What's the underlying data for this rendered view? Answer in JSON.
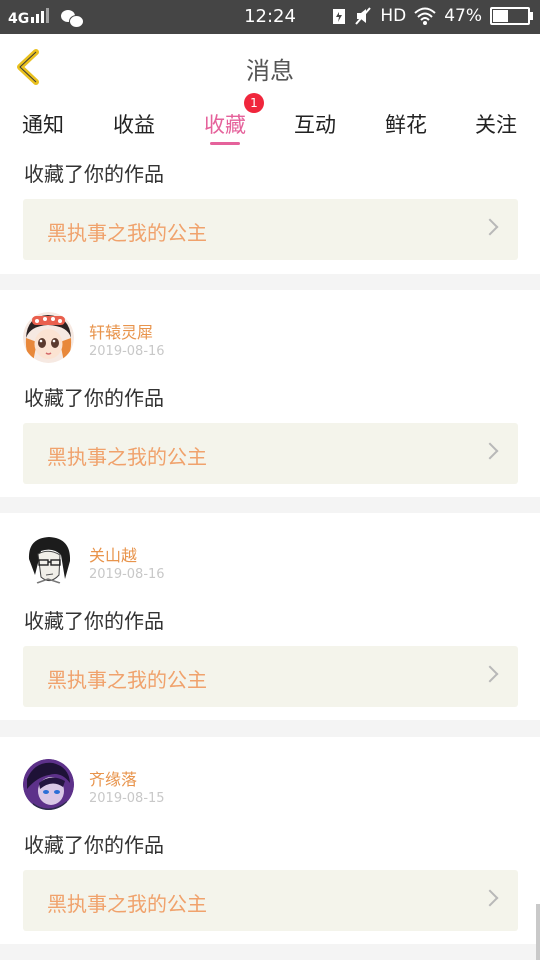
{
  "status_bar": {
    "network": "4G",
    "time": "12:24",
    "hd": "HD",
    "battery": "47%",
    "battery_level": 0.47
  },
  "header": {
    "title": "消息"
  },
  "tabs": [
    {
      "label": "通知"
    },
    {
      "label": "收益"
    },
    {
      "label": "收藏",
      "active": true,
      "badge": "1"
    },
    {
      "label": "互动"
    },
    {
      "label": "鲜花"
    },
    {
      "label": "关注"
    }
  ],
  "messages": [
    {
      "action": "收藏了你的作品",
      "work": "黑执事之我的公主"
    },
    {
      "user": "轩辕灵犀",
      "date": "2019-08-16",
      "action": "收藏了你的作品",
      "work": "黑执事之我的公主"
    },
    {
      "user": "关山越",
      "date": "2019-08-16",
      "action": "收藏了你的作品",
      "work": "黑执事之我的公主"
    },
    {
      "user": "齐缘落",
      "date": "2019-08-15",
      "action": "收藏了你的作品",
      "work": "黑执事之我的公主"
    }
  ],
  "colors": {
    "accent": "#e5629b",
    "username": "#e8944c",
    "work_title": "#f0a26c",
    "badge": "#f0263c",
    "back_arrow": "#e9c01e"
  }
}
